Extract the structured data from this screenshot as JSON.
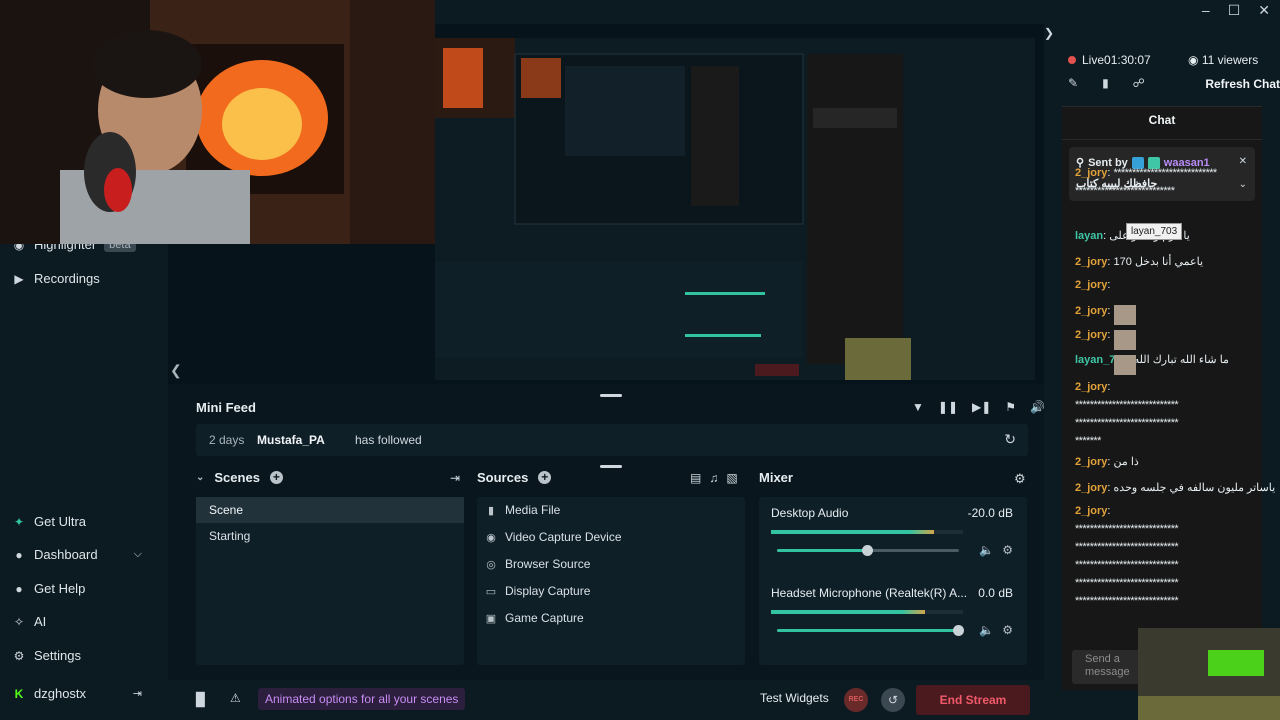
{
  "sidebar": {
    "highlighter": "Highlighter",
    "highlighter_badge": "beta",
    "recordings": "Recordings",
    "get_ultra": "Get Ultra",
    "dashboard": "Dashboard",
    "get_help": "Get Help",
    "ai": "AI",
    "settings": "Settings",
    "account": "dzghostx"
  },
  "mini_feed": {
    "title": "Mini Feed",
    "ago": "2 days",
    "user": "Mustafa_PA",
    "event": "has followed"
  },
  "scenes": {
    "title": "Scenes",
    "items": [
      "Scene",
      "Starting"
    ]
  },
  "sources": {
    "title": "Sources",
    "items": [
      "Media File",
      "Video Capture Device",
      "Browser Source",
      "Display Capture",
      "Game Capture"
    ]
  },
  "mixer": {
    "title": "Mixer",
    "channels": [
      {
        "name": "Desktop Audio",
        "db": "-20.0 dB",
        "level": 0.85,
        "volume": 0.5
      },
      {
        "name": "Headset Microphone (Realtek(R) A...",
        "db": "0.0 dB",
        "level": 0.8,
        "volume": 1.0
      }
    ]
  },
  "footer": {
    "promo": "Animated options for all your scenes",
    "test_widgets": "Test Widgets",
    "rec": "REC",
    "end_stream": "End Stream"
  },
  "chat_panel": {
    "live": "Live",
    "time": "01:30:07",
    "viewers": "11 viewers",
    "refresh": "Refresh Chat",
    "title": "Chat",
    "pinned_sent_by": "Sent by",
    "pinned_user": "waasan1",
    "pinned_msg": "حافظك لبيبه كتاب",
    "tooltip": "layan_703",
    "send_placeholder_1": "Send a",
    "send_placeholder_2": "message"
  },
  "chat_messages": [
    {
      "user": "2_jory",
      "text": "****************************"
    },
    {
      "user": "",
      "text": "***************************"
    },
    {
      "user": "layan",
      "text": "يا قزم وتتنمر على"
    },
    {
      "user": "2_jory",
      "text": "ياعمي أنا بدخل 170"
    },
    {
      "user": "2_jory",
      "text": ""
    },
    {
      "user": "2_jory",
      "text": ""
    },
    {
      "user": "2_jory",
      "text": ""
    },
    {
      "user": "layan_703",
      "text": "ما شاء الله تبارك الله"
    },
    {
      "user": "2_jory",
      "text": ""
    },
    {
      "user": "",
      "text": "****************************"
    },
    {
      "user": "",
      "text": "****************************"
    },
    {
      "user": "",
      "text": "*******"
    },
    {
      "user": "2_jory",
      "text": "ذا من"
    },
    {
      "user": "2_jory",
      "text": "ياساتر مليون سالفه في جلسه وحده"
    },
    {
      "user": "2_jory",
      "text": ""
    },
    {
      "user": "",
      "text": "****************************"
    },
    {
      "user": "",
      "text": "****************************"
    },
    {
      "user": "",
      "text": "****************************"
    },
    {
      "user": "",
      "text": "****************************"
    },
    {
      "user": "",
      "text": "****************************"
    }
  ],
  "colors": {
    "accent": "#31c3a2",
    "danger": "#f25a6a",
    "chat_user": "#e2a23a",
    "promo": "#c98cf5"
  }
}
